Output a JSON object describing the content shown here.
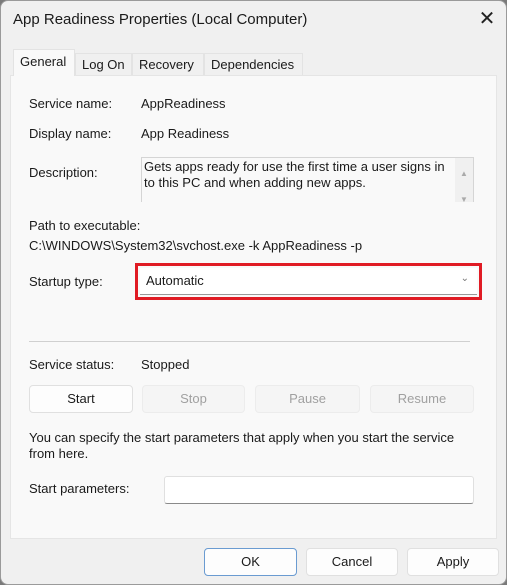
{
  "window": {
    "title": "App Readiness Properties (Local Computer)",
    "close_icon": "close-icon"
  },
  "tabs": [
    {
      "label": "General",
      "selected": true
    },
    {
      "label": "Log On"
    },
    {
      "label": "Recovery"
    },
    {
      "label": "Dependencies"
    }
  ],
  "general": {
    "service_name_label": "Service name:",
    "service_name": "AppReadiness",
    "display_name_label": "Display name:",
    "display_name": "App Readiness",
    "description_label": "Description:",
    "description": "Gets apps ready for use the first time a user signs in to this PC and when adding new apps.",
    "path_label": "Path to executable:",
    "path": "C:\\WINDOWS\\System32\\svchost.exe -k AppReadiness -p",
    "startup_label": "Startup type:",
    "startup_value": "Automatic",
    "highlight_color": "#e01b24",
    "status_label": "Service status:",
    "status_value": "Stopped",
    "buttons": {
      "start": "Start",
      "stop": "Stop",
      "pause": "Pause",
      "resume": "Resume"
    },
    "hint": "You can specify the start parameters that apply when you start the service from here.",
    "params_label": "Start parameters:",
    "params_value": ""
  },
  "footer": {
    "ok": "OK",
    "cancel": "Cancel",
    "apply": "Apply"
  }
}
